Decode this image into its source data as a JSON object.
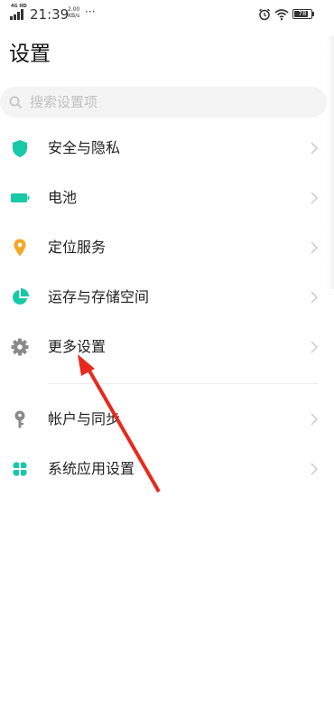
{
  "status_bar": {
    "network": "4G HD",
    "time": "21:39",
    "speed_value": "2.00",
    "speed_unit": "KB/s",
    "more": "···",
    "battery": "78"
  },
  "page": {
    "title": "设置"
  },
  "search": {
    "placeholder": "搜索设置项"
  },
  "items": [
    {
      "label": "安全与隐私",
      "icon": "shield-icon",
      "color": "#18c9a5"
    },
    {
      "label": "电池",
      "icon": "battery-icon",
      "color": "#18c9a5"
    },
    {
      "label": "定位服务",
      "icon": "location-pin-icon",
      "color": "#f5a623"
    },
    {
      "label": "运存与存储空间",
      "icon": "pie-chart-icon",
      "color": "#18c9a5"
    },
    {
      "label": "更多设置",
      "icon": "gear-icon",
      "color": "#8a8a8a"
    },
    {
      "label": "帐户与同步",
      "icon": "key-icon",
      "color": "#8a8a8a"
    },
    {
      "label": "系统应用设置",
      "icon": "apps-grid-icon",
      "color": "#18c9a5"
    }
  ],
  "annotation": {
    "arrow_color": "#e8291c"
  }
}
